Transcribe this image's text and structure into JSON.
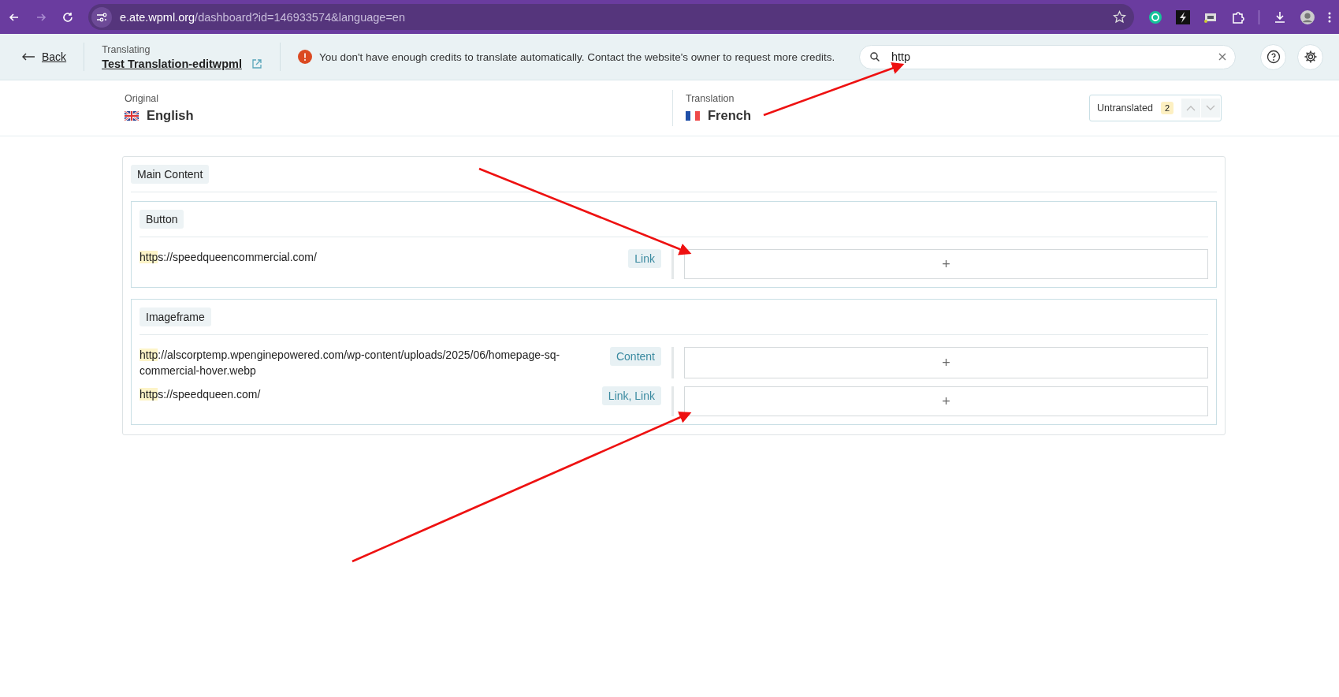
{
  "browser": {
    "url_host": "e.ate.wpml.org",
    "url_path": "/dashboard?id=146933574&language=en"
  },
  "header": {
    "back": "Back",
    "translating_label": "Translating",
    "job_title": "Test Translation-editwpml",
    "notice": "You don't have enough credits to translate automatically. Contact the website's owner to request more credits.",
    "search": {
      "value": "http"
    }
  },
  "languages": {
    "original_label": "Original",
    "original": "English",
    "translation_label": "Translation",
    "translation": "French",
    "filter": {
      "label": "Untranslated",
      "count": "2"
    }
  },
  "content": {
    "title": "Main Content",
    "sections": [
      {
        "title": "Button",
        "segments": [
          {
            "highlight": "http",
            "rest": "s://speedqueencommercial.com/",
            "tag": "Link",
            "target": "+"
          }
        ]
      },
      {
        "title": "Imageframe",
        "segments": [
          {
            "highlight": "http",
            "rest": "://alscorptemp.wpenginepowered.com/wp-content/uploads/2025/06/homepage-sq-commercial-hover.webp",
            "tag": "Content",
            "target": "+"
          },
          {
            "highlight": "http",
            "rest": "s://speedqueen.com/",
            "tag": "Link, Link",
            "target": "+"
          }
        ]
      }
    ]
  }
}
